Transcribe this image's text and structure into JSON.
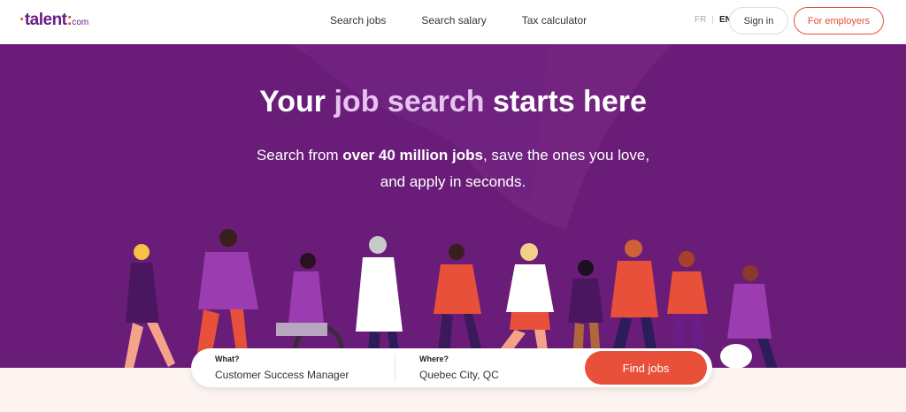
{
  "header": {
    "logo_text": "talent",
    "logo_suffix": "com",
    "nav": [
      "Search jobs",
      "Search salary",
      "Tax calculator"
    ],
    "lang_fr": "FR",
    "lang_sep": "|",
    "lang_en": "EN",
    "signin_label": "Sign in",
    "employers_label": "For employers"
  },
  "hero": {
    "headline_pre": "Your ",
    "headline_accent": "job search",
    "headline_post": " starts here",
    "sub_pre": "Search from ",
    "sub_bold": "over 40 million jobs",
    "sub_post": ", save the ones you love,",
    "sub_line2": "and apply in seconds."
  },
  "search": {
    "what_label": "What?",
    "what_value": "Customer Success Manager",
    "where_label": "Where?",
    "where_value": "Quebec City, QC",
    "button_label": "Find jobs"
  },
  "colors": {
    "brand_purple": "#6a1d78",
    "accent_red": "#e8503a",
    "accent_lilac": "#e6c4ef"
  }
}
